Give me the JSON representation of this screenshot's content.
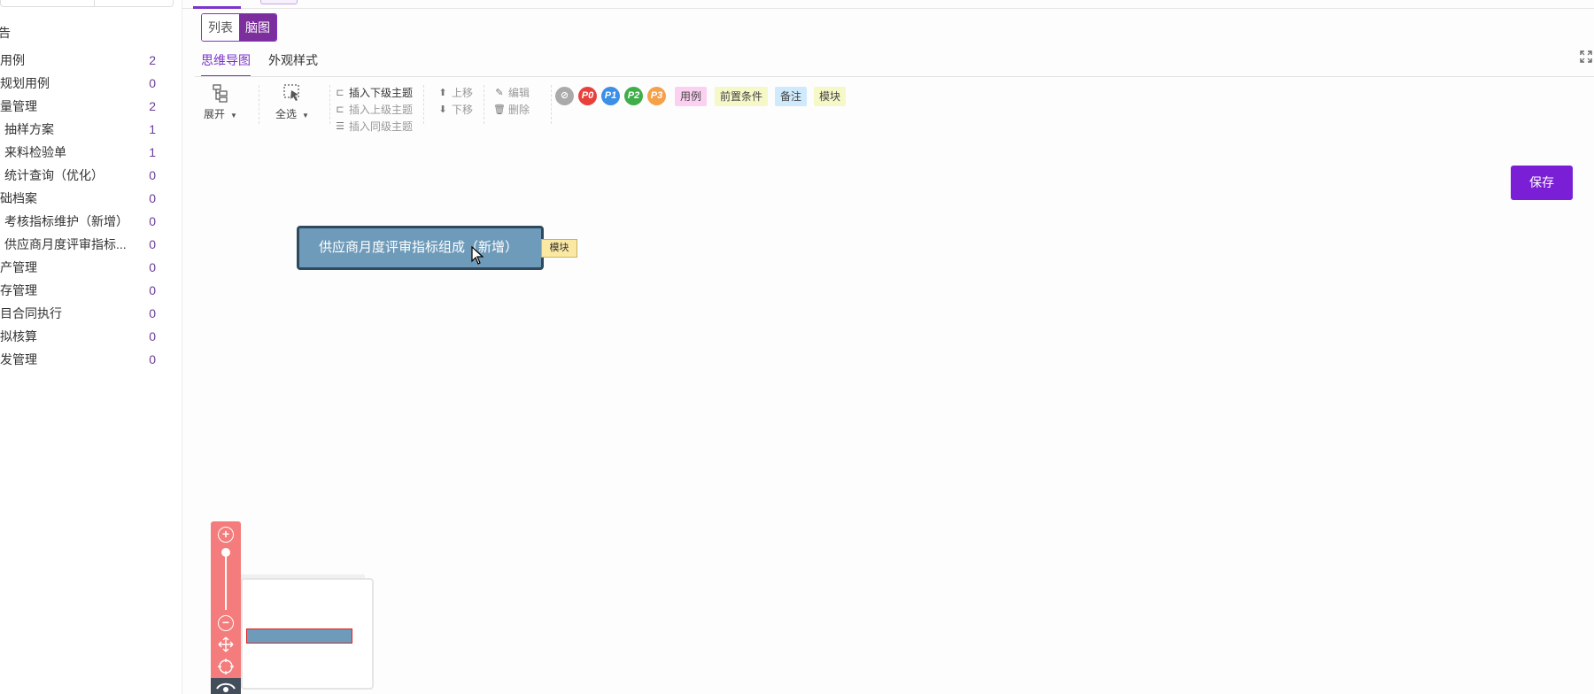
{
  "sidebar": {
    "header": "告",
    "items": [
      {
        "label": "用例",
        "count": "2",
        "child": false
      },
      {
        "label": "规划用例",
        "count": "0",
        "child": false
      },
      {
        "label": "量管理",
        "count": "2",
        "child": false
      },
      {
        "label": "抽样方案",
        "count": "1",
        "child": true
      },
      {
        "label": "来料检验单",
        "count": "1",
        "child": true
      },
      {
        "label": "统计查询（优化）",
        "count": "0",
        "child": true
      },
      {
        "label": "础档案",
        "count": "0",
        "child": false
      },
      {
        "label": "考核指标维护（新增）",
        "count": "0",
        "child": true
      },
      {
        "label": "供应商月度评审指标...",
        "count": "0",
        "child": true
      },
      {
        "label": "产管理",
        "count": "0",
        "child": false
      },
      {
        "label": "存管理",
        "count": "0",
        "child": false
      },
      {
        "label": "目合同执行",
        "count": "0",
        "child": false
      },
      {
        "label": "拟核算",
        "count": "0",
        "child": false
      },
      {
        "label": "发管理",
        "count": "0",
        "child": false
      }
    ]
  },
  "view_toggle": {
    "list": "列表",
    "mindmap": "脑图"
  },
  "subtabs": {
    "mindmap": "思维导图",
    "style": "外观样式"
  },
  "toolbar": {
    "expand": "展开",
    "select_all": "全选",
    "insert_child": "插入下级主题",
    "insert_parent": "插入上级主题",
    "insert_sibling": "插入同级主题",
    "move_up": "上移",
    "move_down": "下移",
    "edit": "编辑",
    "delete": "删除",
    "priorities": [
      "P0",
      "P1",
      "P2",
      "P3"
    ],
    "tags": [
      "用例",
      "前置条件",
      "备注",
      "模块"
    ]
  },
  "save_label": "保存",
  "node": {
    "text": "供应商月度评审指标组成（新增）",
    "tag": "模块"
  },
  "colors": {
    "accent": "#7b35c9",
    "save": "#7b1fd6",
    "node_fill": "#6f9bba",
    "node_border": "#2f4a5e",
    "zoom_bar": "#f47c7c"
  }
}
